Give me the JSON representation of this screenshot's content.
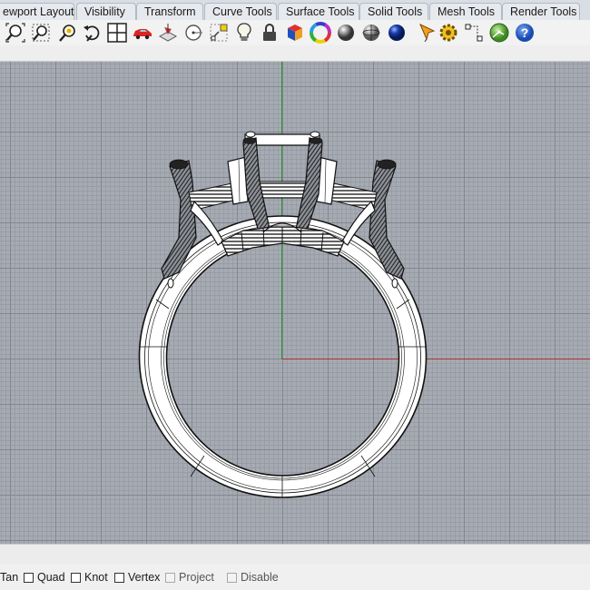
{
  "tabs": [
    "ewport Layout",
    "Visibility",
    "Transform",
    "Curve Tools",
    "Surface Tools",
    "Solid Tools",
    "Mesh Tools",
    "Render Tools"
  ],
  "toolbar": {
    "icons": [
      "zoom-extents-icon",
      "zoom-window-icon",
      "zoom-selected-icon",
      "undo-view-icon",
      "four-viewports-icon",
      "car-icon",
      "plane-icon",
      "circle-snap-icon",
      "point-icon",
      "light-bulb-icon",
      "lock-icon",
      "material-cube-icon",
      "color-wheel-icon",
      "shaded-sphere-icon",
      "ghosted-sphere-icon",
      "rendered-sphere-icon",
      "pen-icon",
      "gear-icon",
      "dimension-icon",
      "globe-icon",
      "help-icon"
    ]
  },
  "viewport": {
    "axis_x_color": "#b03030",
    "axis_y_color": "#1d9a2c",
    "grid_color": "#a6aab2"
  },
  "osnaps": [
    {
      "label": "Tan",
      "checkbox": false,
      "enabled": true
    },
    {
      "label": "Quad",
      "checkbox": true,
      "checked": false,
      "enabled": true
    },
    {
      "label": "Knot",
      "checkbox": true,
      "checked": false,
      "enabled": true
    },
    {
      "label": "Vertex",
      "checkbox": true,
      "checked": false,
      "enabled": true
    },
    {
      "label": "Project",
      "checkbox": true,
      "checked": false,
      "enabled": false
    },
    {
      "label": "Disable",
      "checkbox": true,
      "checked": false,
      "enabled": false
    }
  ]
}
